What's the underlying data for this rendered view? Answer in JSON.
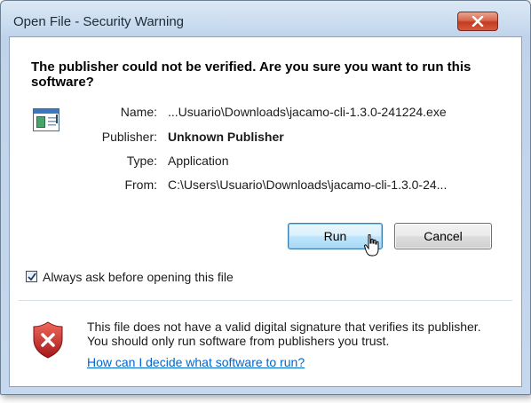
{
  "window": {
    "title": "Open File - Security Warning"
  },
  "headline": "The publisher could not be verified.  Are you sure you want to run this software?",
  "details": [
    {
      "label": "Name:",
      "value": "...Usuario\\Downloads\\jacamo-cli-1.3.0-241224.exe"
    },
    {
      "label": "Publisher:",
      "value": "Unknown Publisher"
    },
    {
      "label": "Type:",
      "value": "Application"
    },
    {
      "label": "From:",
      "value": "C:\\Users\\Usuario\\Downloads\\jacamo-cli-1.3.0-24..."
    }
  ],
  "buttons": {
    "run": "Run",
    "cancel": "Cancel"
  },
  "checkbox": {
    "label": "Always ask before opening this file",
    "checked": true
  },
  "warning": {
    "text": "This file does not have a valid digital signature that verifies its publisher.  You should only run software from publishers you trust.",
    "link": "How can I decide what software to run?"
  },
  "colors": {
    "close_button": "#c23b22",
    "link": "#0066cc",
    "shield": "#c0282b"
  },
  "icons": [
    "close-icon",
    "application-file-icon",
    "mouse-cursor-icon",
    "checkmark-icon",
    "security-shield-icon"
  ]
}
